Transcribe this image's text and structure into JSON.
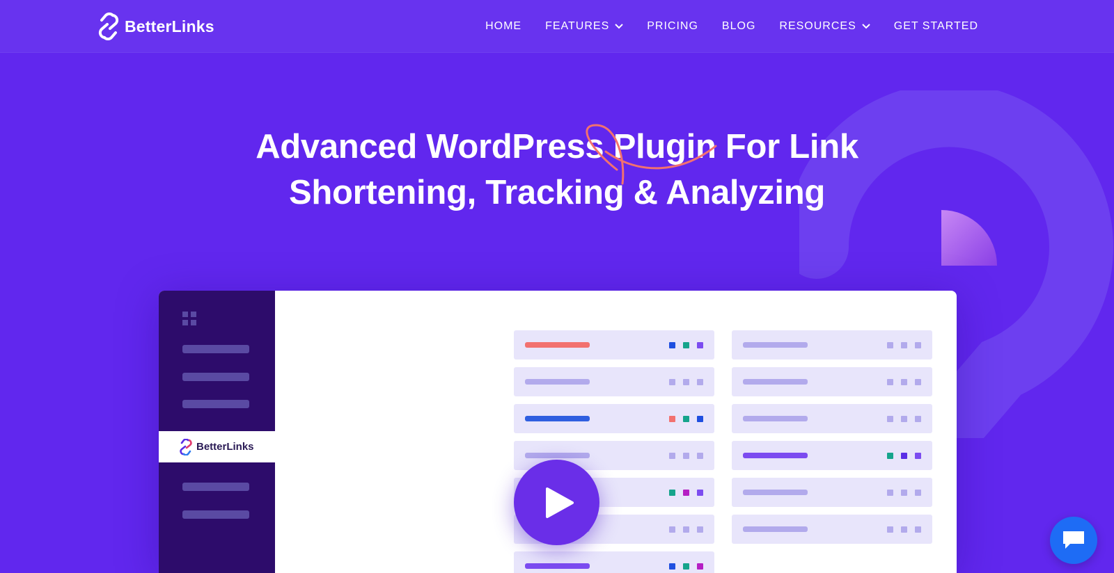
{
  "brand": {
    "name": "BetterLinks"
  },
  "nav": [
    {
      "label": "HOME",
      "dropdown": false
    },
    {
      "label": "FEATURES",
      "dropdown": true
    },
    {
      "label": "PRICING",
      "dropdown": false
    },
    {
      "label": "BLOG",
      "dropdown": false
    },
    {
      "label": "RESOURCES",
      "dropdown": true
    },
    {
      "label": "GET STARTED",
      "dropdown": false
    }
  ],
  "hero": {
    "title_line1": "Advanced WordPress Plugin For Link",
    "title_line2": "Shortening, Tracking & Analyzing"
  },
  "preview": {
    "active_item_label": "BetterLinks",
    "play_icon": "play-icon"
  },
  "chat": {
    "icon": "chat-bubble-icon"
  },
  "colors": {
    "background": "#6127ee",
    "header": "#6833ef",
    "sidebar": "#2d0c6b",
    "row": "#e8e5fb",
    "accent_red": "#f2716f",
    "accent_blue": "#2f5fe0",
    "accent_purple": "#7c4cf0",
    "chat": "#1e6cf5"
  }
}
